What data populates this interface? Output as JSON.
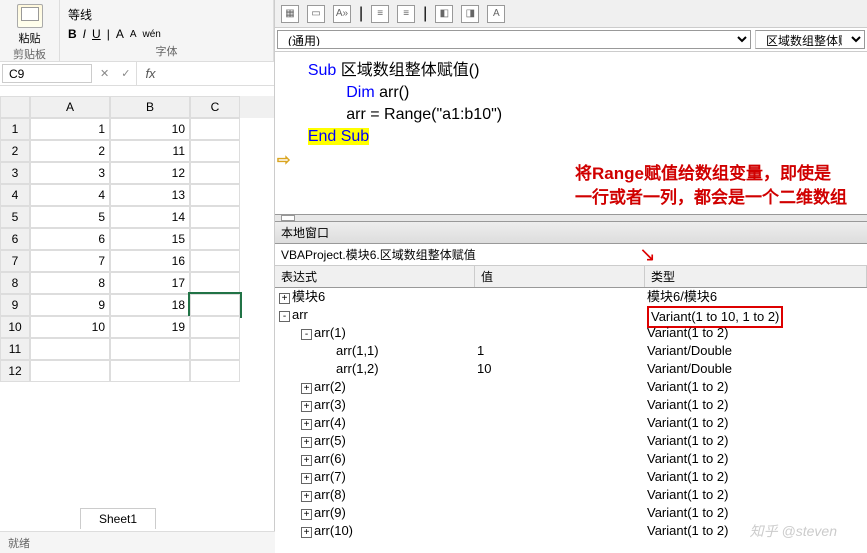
{
  "excel": {
    "ribbon": {
      "paste_label": "粘贴",
      "clipboard_label": "剪贴板",
      "font_label": "字体",
      "line_style": "等线",
      "b": "B",
      "i": "I",
      "u": "U",
      "a1": "A",
      "a2": "A",
      "wen": "wén"
    },
    "namebox": "C9",
    "fx_cancel": "✕",
    "fx_ok": "✓",
    "fx": "fx",
    "columns": [
      "A",
      "B",
      "C"
    ],
    "rows": [
      {
        "n": "1",
        "a": "1",
        "b": "10"
      },
      {
        "n": "2",
        "a": "2",
        "b": "11"
      },
      {
        "n": "3",
        "a": "3",
        "b": "12"
      },
      {
        "n": "4",
        "a": "4",
        "b": "13"
      },
      {
        "n": "5",
        "a": "5",
        "b": "14"
      },
      {
        "n": "6",
        "a": "6",
        "b": "15"
      },
      {
        "n": "7",
        "a": "7",
        "b": "16"
      },
      {
        "n": "8",
        "a": "8",
        "b": "17"
      },
      {
        "n": "9",
        "a": "9",
        "b": "18"
      },
      {
        "n": "10",
        "a": "10",
        "b": "19"
      }
    ],
    "extra_rows": [
      "11",
      "12"
    ],
    "sheet_tab": "Sheet1",
    "status": "就绪"
  },
  "vba": {
    "dropdown_left": "(通用)",
    "dropdown_right": "区域数组整体赋",
    "code": {
      "l1a": "Sub ",
      "l1b": "区域数组整体赋值()",
      "l2a": "Dim ",
      "l2b": "arr()",
      "l3": "arr = Range(\"a1:b10\")",
      "l4": "End Sub"
    },
    "annotation_line1": "将Range赋值给数组变量，即使是",
    "annotation_line2": "一行或者一列，都会是一个二维数组",
    "locals_title": "本地窗口",
    "project_line": "VBAProject.模块6.区域数组整体赋值",
    "locals_headers": {
      "expr": "表达式",
      "val": "值",
      "type": "类型"
    },
    "locals": [
      {
        "icon": "+",
        "indent": 0,
        "expr": "模块6",
        "val": "",
        "type": "模块6/模块6",
        "red": false
      },
      {
        "icon": "-",
        "indent": 0,
        "expr": "arr",
        "val": "",
        "type": "Variant(1 to 10, 1 to 2)",
        "red": true
      },
      {
        "icon": "-",
        "indent": 1,
        "expr": "arr(1)",
        "val": "",
        "type": "Variant(1 to 2)",
        "red": false
      },
      {
        "icon": "",
        "indent": 2,
        "expr": "arr(1,1)",
        "val": "1",
        "type": "Variant/Double",
        "red": false
      },
      {
        "icon": "",
        "indent": 2,
        "expr": "arr(1,2)",
        "val": "10",
        "type": "Variant/Double",
        "red": false
      },
      {
        "icon": "+",
        "indent": 1,
        "expr": "arr(2)",
        "val": "",
        "type": "Variant(1 to 2)",
        "red": false
      },
      {
        "icon": "+",
        "indent": 1,
        "expr": "arr(3)",
        "val": "",
        "type": "Variant(1 to 2)",
        "red": false
      },
      {
        "icon": "+",
        "indent": 1,
        "expr": "arr(4)",
        "val": "",
        "type": "Variant(1 to 2)",
        "red": false
      },
      {
        "icon": "+",
        "indent": 1,
        "expr": "arr(5)",
        "val": "",
        "type": "Variant(1 to 2)",
        "red": false
      },
      {
        "icon": "+",
        "indent": 1,
        "expr": "arr(6)",
        "val": "",
        "type": "Variant(1 to 2)",
        "red": false
      },
      {
        "icon": "+",
        "indent": 1,
        "expr": "arr(7)",
        "val": "",
        "type": "Variant(1 to 2)",
        "red": false
      },
      {
        "icon": "+",
        "indent": 1,
        "expr": "arr(8)",
        "val": "",
        "type": "Variant(1 to 2)",
        "red": false
      },
      {
        "icon": "+",
        "indent": 1,
        "expr": "arr(9)",
        "val": "",
        "type": "Variant(1 to 2)",
        "red": false
      },
      {
        "icon": "+",
        "indent": 1,
        "expr": "arr(10)",
        "val": "",
        "type": "Variant(1 to 2)",
        "red": false
      }
    ]
  },
  "watermark": "知乎 @steven"
}
